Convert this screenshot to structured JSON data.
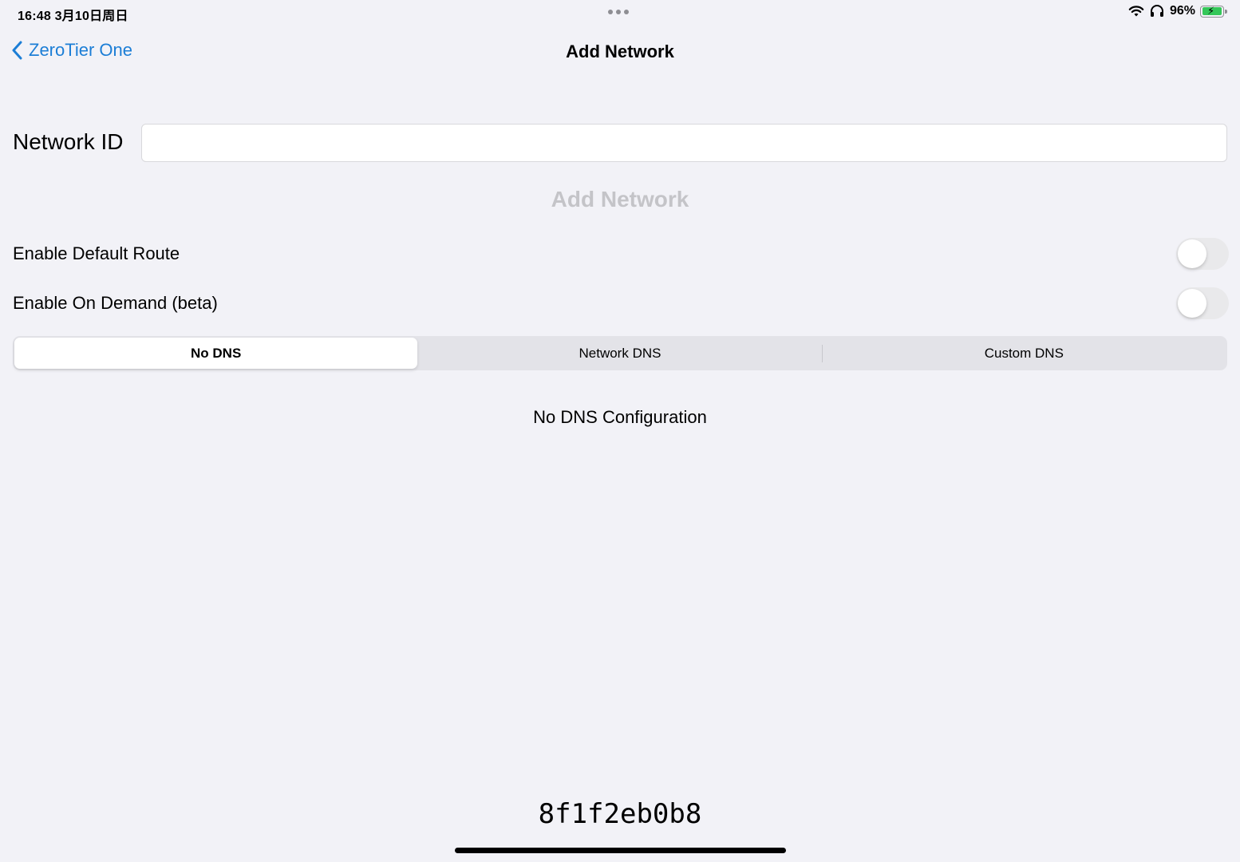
{
  "status_bar": {
    "time_date": "16:48   3月10日周日",
    "battery_percent": "96%",
    "battery_level": 0.96,
    "icons": [
      "wifi-icon",
      "headphones-icon",
      "battery-charging-icon"
    ]
  },
  "nav": {
    "back_label": "ZeroTier One",
    "title": "Add Network",
    "accent_color": "#1c7ed6"
  },
  "form": {
    "network_id_label": "Network ID",
    "network_id_value": "",
    "add_button_label": "Add Network",
    "add_button_enabled": false
  },
  "toggles": [
    {
      "label": "Enable Default Route",
      "on": false
    },
    {
      "label": "Enable On Demand (beta)",
      "on": false
    }
  ],
  "dns": {
    "options": [
      "No DNS",
      "Network DNS",
      "Custom DNS"
    ],
    "selected": "No DNS",
    "message": "No DNS Configuration"
  },
  "footer": {
    "node_id": "8f1f2eb0b8"
  }
}
